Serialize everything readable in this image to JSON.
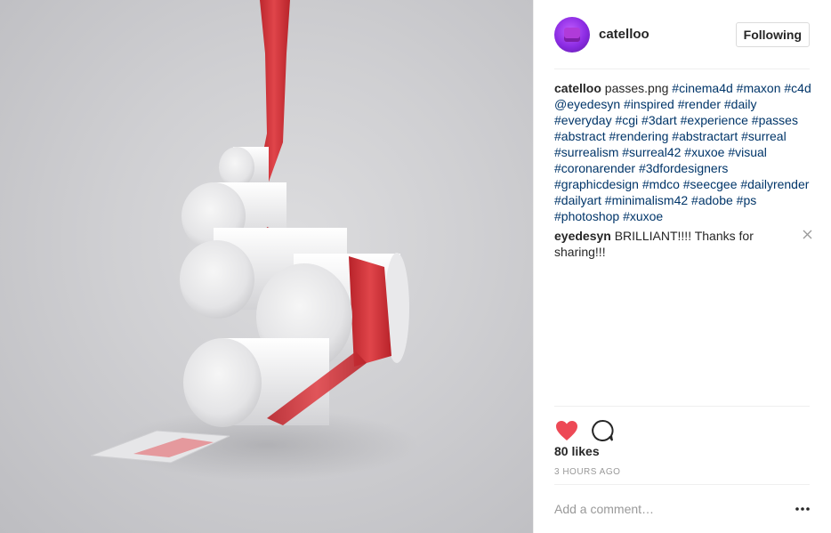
{
  "post": {
    "author": "catelloo",
    "follow_label": "Following",
    "caption_author": "catelloo",
    "caption_text": "passes.png",
    "caption_hashtags": "#cinema4d #maxon #c4d @eyedesyn #inspired #render #daily #everyday #cgi #3dart #experience #passes #abstract #rendering #abstractart #surreal #surrealism #surreal42 #xuxoe #visual #coronarender #3dfordesigners #graphicdesign #mdco #seecgee #dailyrender #dailyart #minimalism42 #adobe #ps #photoshop #xuxoe",
    "reply_author": "eyedesyn",
    "reply_text": "BRILLIANT!!!! Thanks for sharing!!!",
    "likes": "80 likes",
    "timestamp": "3 HOURS AGO",
    "comment_placeholder": "Add a comment…"
  },
  "icons": {
    "like": "heart-icon",
    "comment": "speech-bubble-icon",
    "remove": "close-icon",
    "more": "more-options-icon"
  },
  "colors": {
    "heart": "#ed4956",
    "hashtag": "#003569",
    "muted": "#999999",
    "ribbon": "#d9343a"
  }
}
